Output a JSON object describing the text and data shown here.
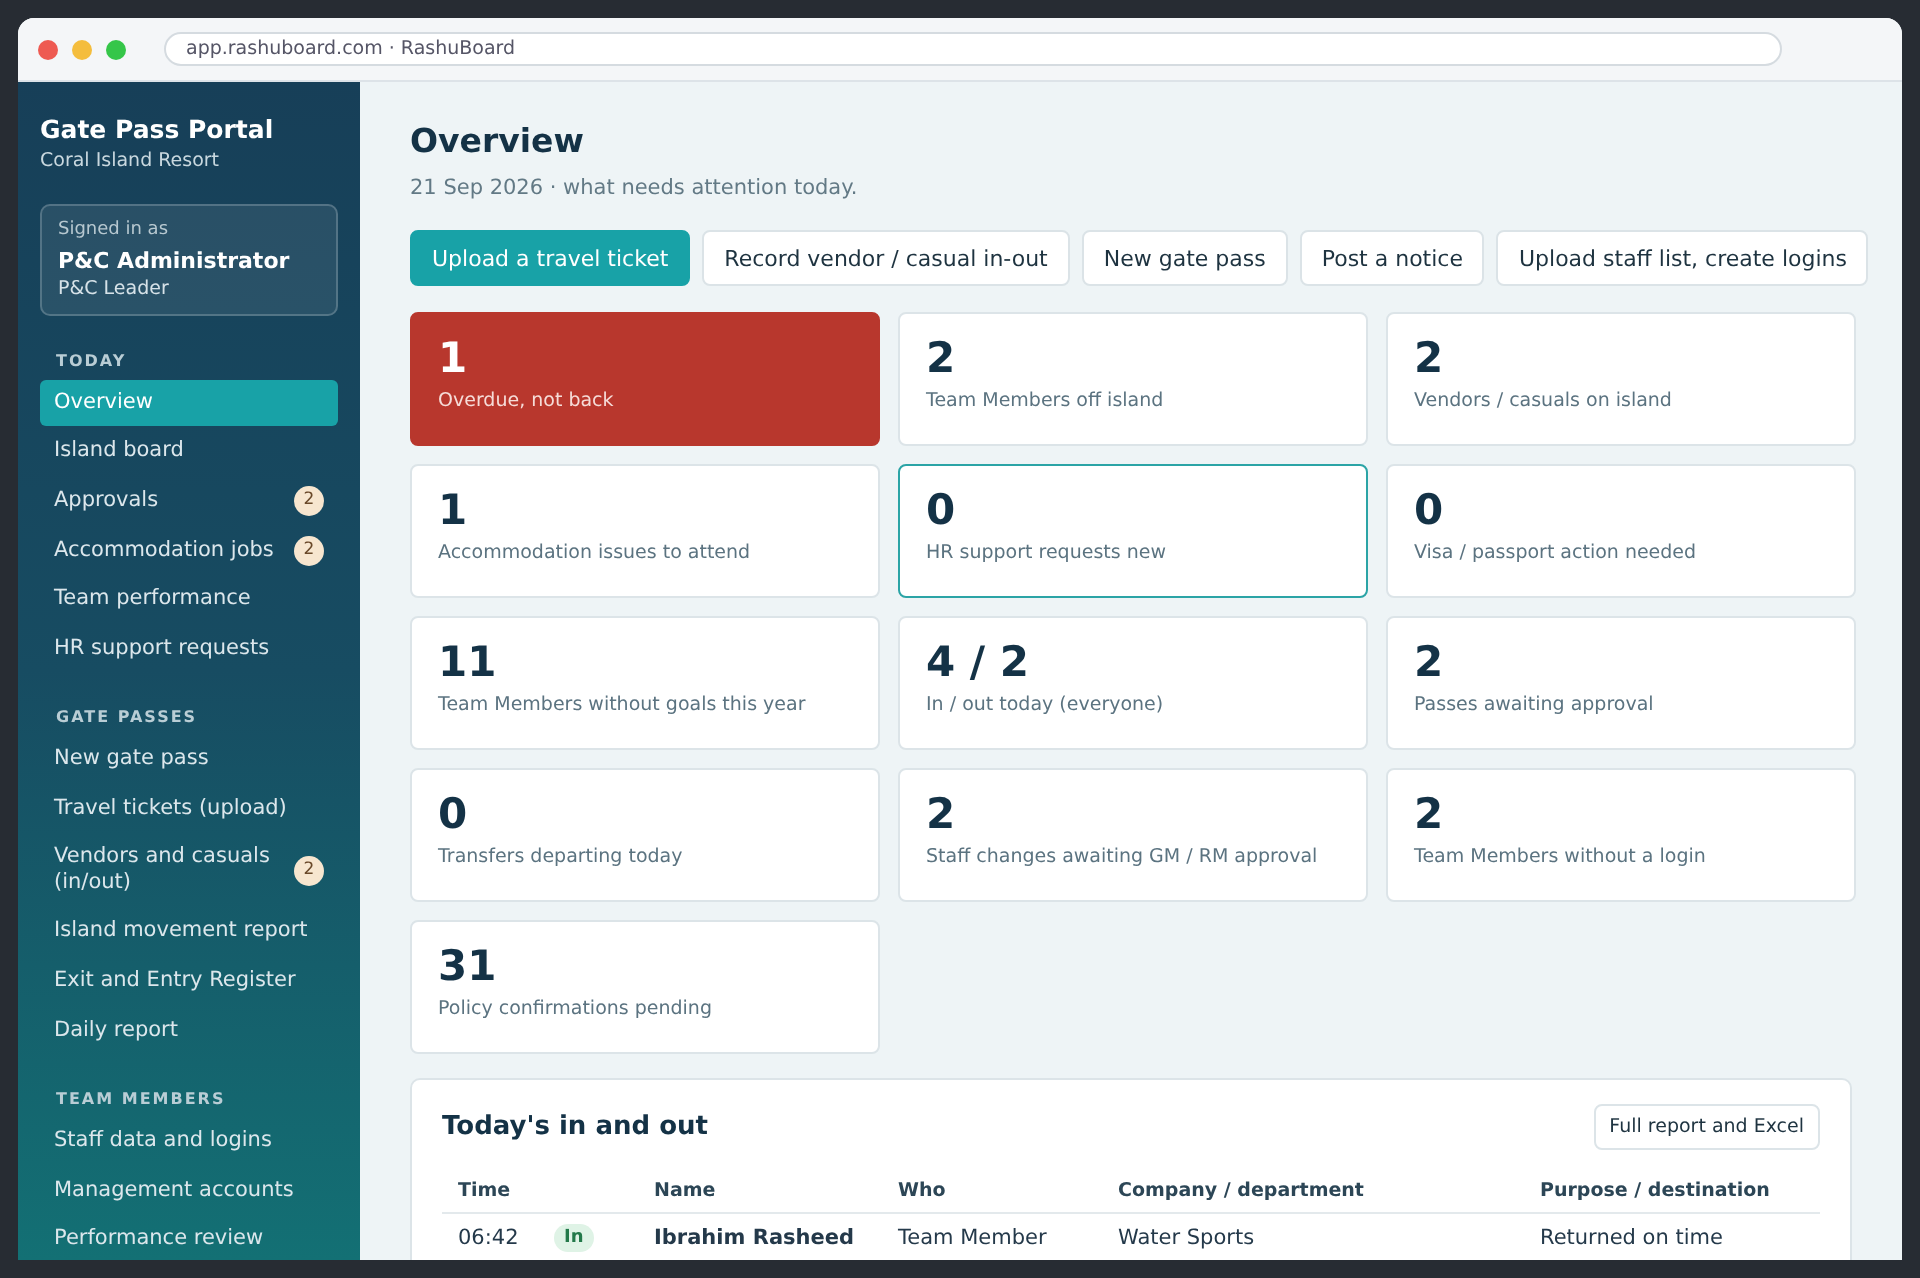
{
  "browser": {
    "address": "app.rashuboard.com · RashuBoard"
  },
  "sidebar": {
    "title": "Gate Pass Portal",
    "subtitle": "Coral Island Resort",
    "user": {
      "caption": "Signed in as",
      "name": "P&C Administrator",
      "role": "P&C Leader"
    },
    "sections": [
      {
        "heading": "TODAY",
        "items": [
          {
            "label": "Overview",
            "selected": true
          },
          {
            "label": "Island board",
            "selected": false
          },
          {
            "label": "Approvals",
            "selected": false,
            "badge": "2"
          },
          {
            "label": "Accommodation jobs",
            "selected": false,
            "badge": "2"
          },
          {
            "label": "Team performance",
            "selected": false
          },
          {
            "label": "HR support requests",
            "selected": false
          }
        ]
      },
      {
        "heading": "GATE PASSES",
        "items": [
          {
            "label": "New gate pass",
            "selected": false
          },
          {
            "label": "Travel tickets (upload)",
            "selected": false
          },
          {
            "label": "Vendors and casuals (in/out)",
            "selected": false,
            "badge": "2"
          },
          {
            "label": "Island movement report",
            "selected": false
          },
          {
            "label": "Exit and Entry Register",
            "selected": false
          },
          {
            "label": "Daily report",
            "selected": false
          }
        ]
      },
      {
        "heading": "TEAM MEMBERS",
        "items": [
          {
            "label": "Staff data and logins",
            "selected": false
          },
          {
            "label": "Management accounts",
            "selected": false
          },
          {
            "label": "Performance review",
            "selected": false
          }
        ]
      }
    ]
  },
  "page": {
    "title": "Overview",
    "subtitle": "21 Sep 2026 · what needs attention today."
  },
  "actions": [
    {
      "label": "Upload a travel ticket",
      "kind": "primary"
    },
    {
      "label": "Record vendor / casual in-out",
      "kind": "secondary"
    },
    {
      "label": "New gate pass",
      "kind": "secondary"
    },
    {
      "label": "Post a notice",
      "kind": "secondary"
    },
    {
      "label": "Upload staff list, create logins",
      "kind": "secondary"
    }
  ],
  "stats": [
    {
      "value": "1",
      "label": "Overdue, not back",
      "kind": "alert"
    },
    {
      "value": "2",
      "label": "Team Members off island",
      "kind": "normal"
    },
    {
      "value": "2",
      "label": "Vendors / casuals on island",
      "kind": "normal"
    },
    {
      "value": "1",
      "label": "Accommodation issues to attend",
      "kind": "normal"
    },
    {
      "value": "0",
      "label": "HR support requests new",
      "kind": "focus"
    },
    {
      "value": "0",
      "label": "Visa / passport action needed",
      "kind": "normal"
    },
    {
      "value": "11",
      "label": "Team Members without goals this year",
      "kind": "normal"
    },
    {
      "value": "4 / 2",
      "label": "In / out today (everyone)",
      "kind": "normal"
    },
    {
      "value": "2",
      "label": "Passes awaiting approval",
      "kind": "normal"
    },
    {
      "value": "0",
      "label": "Transfers departing today",
      "kind": "normal"
    },
    {
      "value": "2",
      "label": "Staff changes awaiting GM / RM approval",
      "kind": "normal"
    },
    {
      "value": "2",
      "label": "Team Members without a login",
      "kind": "normal"
    },
    {
      "value": "31",
      "label": "Policy confirmations pending",
      "kind": "normal"
    }
  ],
  "movements": {
    "title": "Today's in and out",
    "button": "Full report and Excel",
    "columns": [
      "Time",
      "Name",
      "Who",
      "Company / department",
      "Purpose / destination"
    ],
    "rows": [
      {
        "time": "06:42",
        "direction": "In",
        "name": "Ibrahim Rasheed",
        "who": "Team Member",
        "company": "Water Sports",
        "purpose": "Returned on time"
      }
    ]
  }
}
